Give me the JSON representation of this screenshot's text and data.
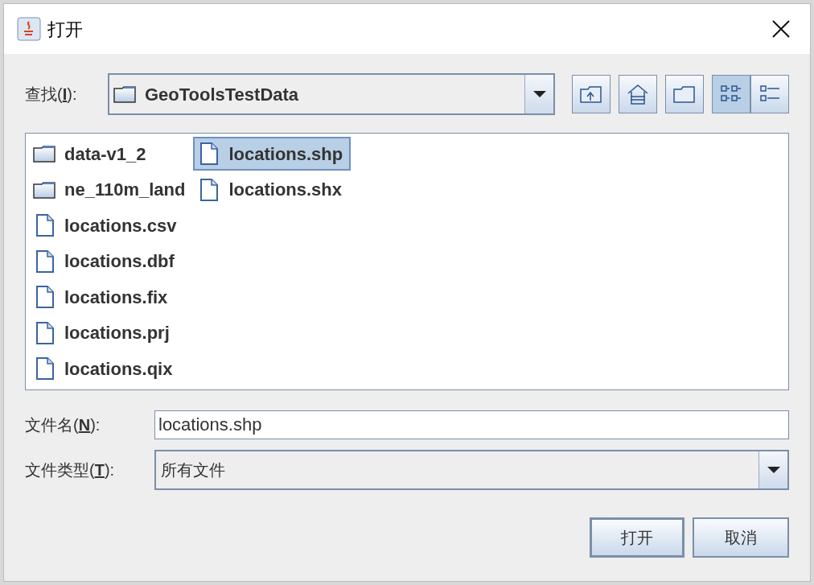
{
  "window": {
    "title": "打开"
  },
  "look_in": {
    "label": {
      "before": "查找(",
      "mnemonic": "I",
      "after": "):"
    },
    "value": "GeoToolsTestData"
  },
  "toolbar": [
    {
      "kind": "up",
      "selected": false
    },
    {
      "kind": "home",
      "selected": false
    },
    {
      "kind": "new-folder",
      "selected": false
    },
    {
      "kind": "list-view",
      "selected": true
    },
    {
      "kind": "details-view",
      "selected": false
    }
  ],
  "files": [
    {
      "kind": "folder",
      "name": "data-v1_2",
      "selected": false
    },
    {
      "kind": "folder",
      "name": "ne_110m_land",
      "selected": false
    },
    {
      "kind": "file",
      "name": "locations.csv",
      "selected": false
    },
    {
      "kind": "file",
      "name": "locations.dbf",
      "selected": false
    },
    {
      "kind": "file",
      "name": "locations.fix",
      "selected": false
    },
    {
      "kind": "file",
      "name": "locations.prj",
      "selected": false
    },
    {
      "kind": "file",
      "name": "locations.qix",
      "selected": false
    },
    {
      "kind": "file",
      "name": "locations.shp",
      "selected": true
    },
    {
      "kind": "file",
      "name": "locations.shx",
      "selected": false
    }
  ],
  "file_name": {
    "label": {
      "before": "文件名(",
      "mnemonic": "N",
      "after": "):"
    },
    "value": "locations.shp"
  },
  "file_type": {
    "label": {
      "before": "文件类型(",
      "mnemonic": "T",
      "after": "):"
    },
    "value": "所有文件"
  },
  "buttons": [
    "打开",
    "取消"
  ]
}
